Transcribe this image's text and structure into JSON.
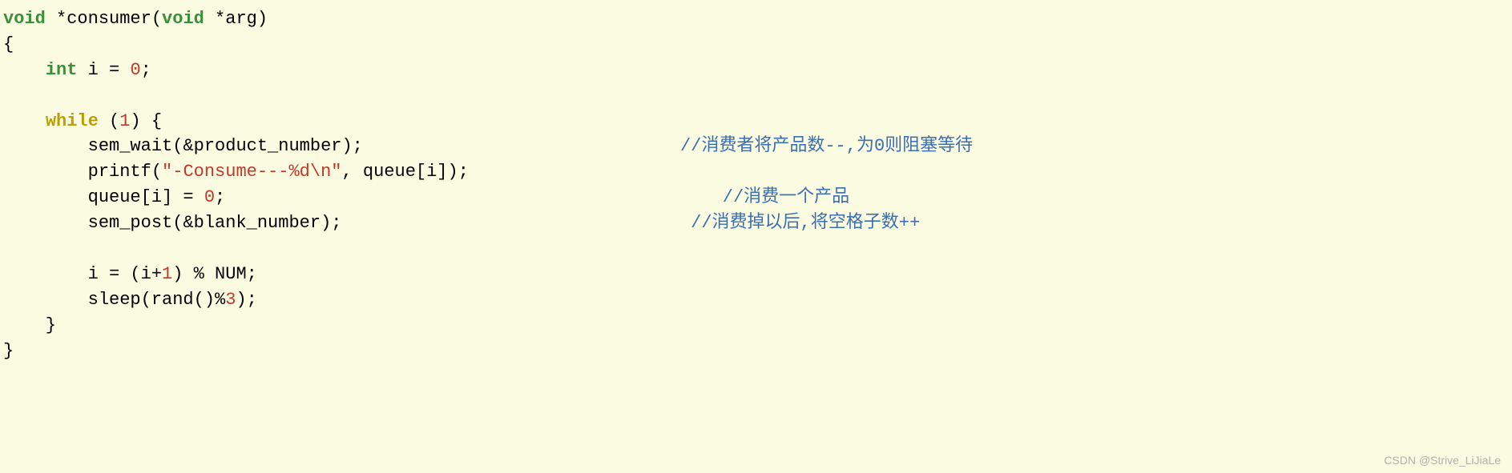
{
  "code": {
    "tokens": {
      "void": "void",
      "int": "int",
      "while": "while"
    },
    "fn_name": "*consumer(",
    "fn_param": " *arg)",
    "brace_open": "{",
    "brace_close": "}",
    "decl_i": " i = ",
    "zero": "0",
    "semicolon": ";",
    "while_cond_open": " (",
    "one": "1",
    "while_cond_close": ") {",
    "line_semwait": "        sem_wait(&product_number);",
    "line_printf_a": "        printf(",
    "line_printf_str": "\"-Consume---%d\\n\"",
    "line_printf_b": ", queue[i]);",
    "line_queue_a": "        queue[i] = ",
    "line_sempost": "        sem_post(&blank_number);",
    "line_inc_a": "        i = (i+",
    "line_inc_b": ") % NUM;",
    "line_sleep_a": "        sleep(rand()%",
    "three": "3",
    "line_sleep_b": ");",
    "inner_close": "    }",
    "comment1": "//消费者将产品数--,为0则阻塞等待",
    "comment2": "//消费一个产品",
    "comment3": "//消费掉以后,将空格子数++",
    "pad1": "                              ",
    "pad2": "                                               ",
    "pad3": "                                 "
  },
  "watermark": "CSDN @Strive_LiJiaLe"
}
